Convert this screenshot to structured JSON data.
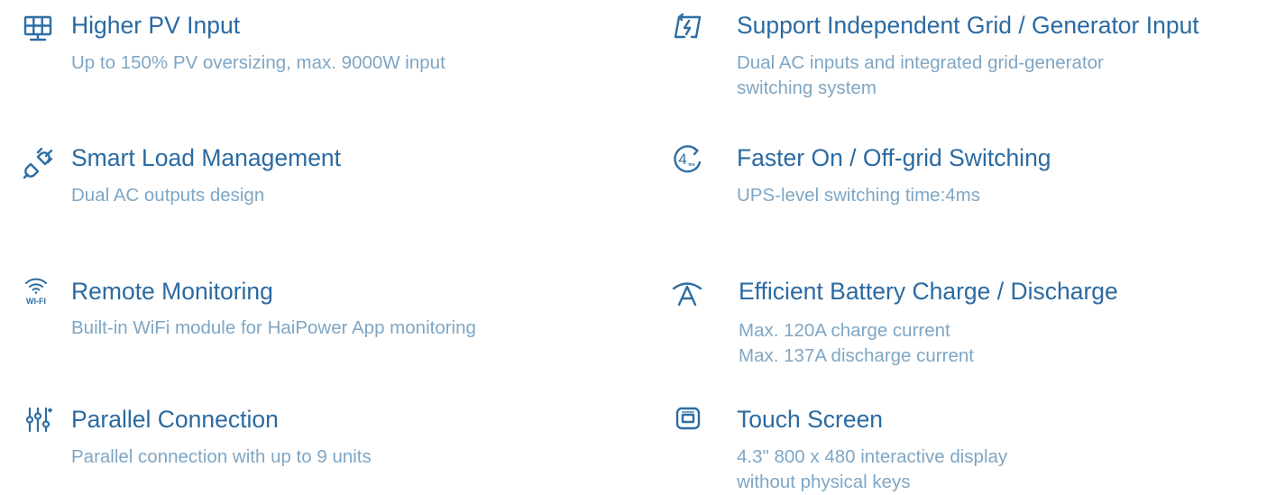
{
  "features": [
    {
      "title": "Higher PV Input",
      "desc": [
        "Up to 150% PV oversizing, max. 9000W input"
      ],
      "icon": "solar-panel-icon"
    },
    {
      "title": "Support Independent Grid / Generator Input",
      "desc": [
        "Dual AC inputs and integrated grid-generator",
        "switching system"
      ],
      "icon": "grid-generator-icon"
    },
    {
      "title": "Smart Load Management",
      "desc": [
        "Dual AC outputs design"
      ],
      "icon": "plug-icon"
    },
    {
      "title": "Faster On / Off-grid Switching",
      "desc": [
        "UPS-level switching time:4ms"
      ],
      "icon": "switching-time-icon",
      "icon_text": "4",
      "icon_subtext": "ms"
    },
    {
      "title": "Remote Monitoring",
      "desc": [
        "Built-in WiFi module for HaiPower App monitoring"
      ],
      "icon": "wifi-icon",
      "icon_text": "WI-FI"
    },
    {
      "title": "Efficient Battery Charge / Discharge",
      "desc": [
        "Max. 120A charge current",
        "Max. 137A discharge current"
      ],
      "icon": "current-icon"
    },
    {
      "title": "Parallel Connection",
      "desc": [
        "Parallel connection with up to 9 units"
      ],
      "icon": "parallel-connection-icon"
    },
    {
      "title": "Touch Screen",
      "desc": [
        "4.3\" 800 x 480 interactive display",
        "without physical keys"
      ],
      "icon": "touch-screen-icon"
    }
  ],
  "colors": {
    "title": "#2b6aa1",
    "description": "#7fa6c4",
    "icon": "#2d6ea3"
  }
}
